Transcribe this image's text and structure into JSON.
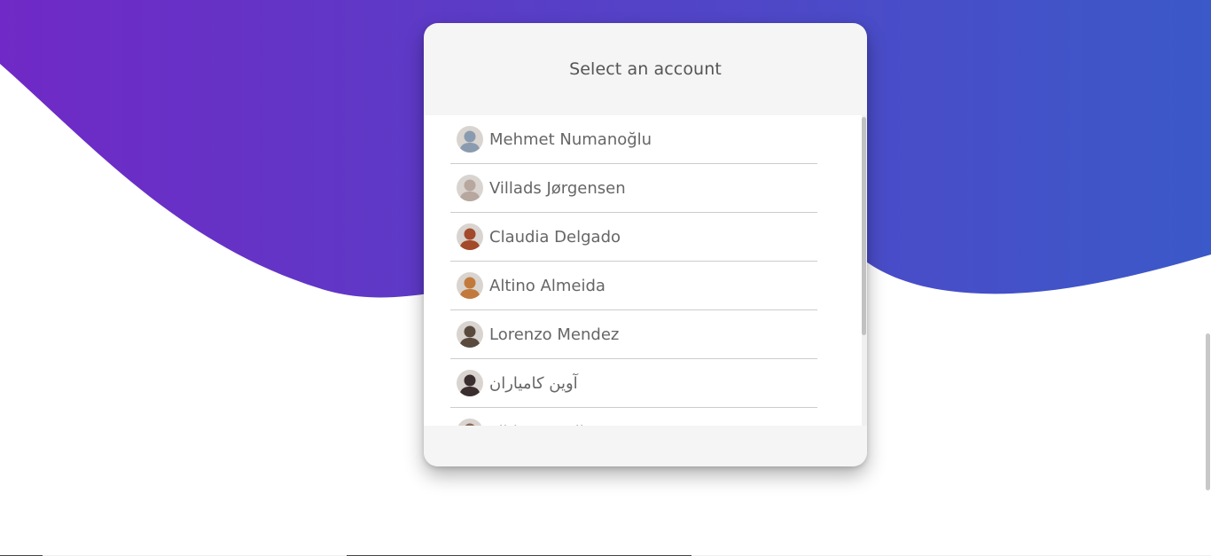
{
  "theme": {
    "gradient_start": "#7029c6",
    "gradient_end": "#3b59c8",
    "card_background": "#f5f5f5",
    "list_background": "#ffffff",
    "text_color": "#666666"
  },
  "dialog": {
    "title": "Select an account"
  },
  "accounts": [
    {
      "name": "Mehmet Numanoğlu",
      "avatar_icon": "user-avatar-icon",
      "avatar_color": "#8a9bb0"
    },
    {
      "name": "Villads Jørgensen",
      "avatar_icon": "user-avatar-icon",
      "avatar_color": "#b7a79e"
    },
    {
      "name": "Claudia Delgado",
      "avatar_icon": "user-avatar-icon",
      "avatar_color": "#a34a2a"
    },
    {
      "name": "Altino Almeida",
      "avatar_icon": "user-avatar-icon",
      "avatar_color": "#c27a3c"
    },
    {
      "name": "Lorenzo Mendez",
      "avatar_icon": "user-avatar-icon",
      "avatar_color": "#5a4a3e"
    },
    {
      "name": "آوین کامیاران",
      "avatar_icon": "user-avatar-icon",
      "avatar_color": "#3a2e2e"
    },
    {
      "name": "Pihla Marttila",
      "avatar_icon": "user-avatar-icon",
      "avatar_color": "#8a6a5a"
    }
  ]
}
